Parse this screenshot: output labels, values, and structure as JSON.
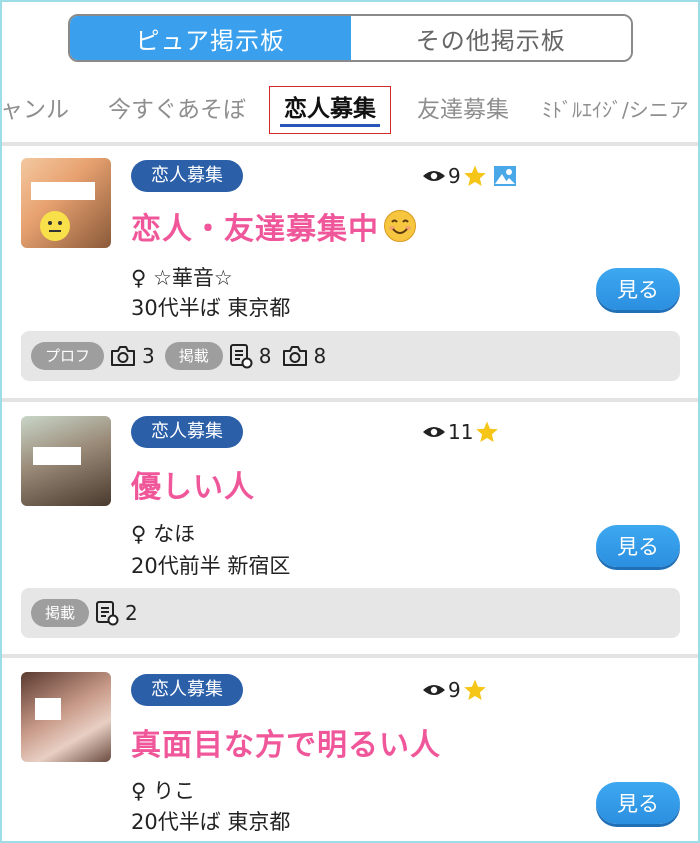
{
  "segments": [
    {
      "label": "ピュア掲示板",
      "active": true
    },
    {
      "label": "その他掲示板",
      "active": false
    }
  ],
  "categories": [
    {
      "label": "ャンル"
    },
    {
      "label": "今すぐあそぼ"
    },
    {
      "label": "恋人募集",
      "active": true
    },
    {
      "label": "友達募集"
    },
    {
      "label": "ﾐﾄﾞﾙｴｲｼﾞ/シニア"
    }
  ],
  "posts": [
    {
      "category": "恋人募集",
      "views": "9",
      "title": "恋人・友達募集中",
      "gender": "♀",
      "name": "☆華音☆",
      "age": "30代半ば",
      "area": "東京都",
      "button": "見る",
      "stats": {
        "profile_label": "プロフ",
        "profile_photos": "3",
        "posted_label": "掲載",
        "posted_count": "8",
        "posted_photos": "8"
      }
    },
    {
      "category": "恋人募集",
      "views": "11",
      "title": "優しい人",
      "gender": "♀",
      "name": "なほ",
      "age": "20代前半",
      "area": "新宿区",
      "button": "見る",
      "stats": {
        "posted_label": "掲載",
        "posted_count": "2"
      }
    },
    {
      "category": "恋人募集",
      "views": "9",
      "title": "真面目な方で明るい人",
      "gender": "♀",
      "name": "りこ",
      "age": "20代半ば",
      "area": "東京都",
      "button": "見る"
    }
  ],
  "icons": {
    "eye": "eye-icon",
    "star": "star-icon",
    "image": "image-icon",
    "camera": "camera-icon",
    "document": "document-icon",
    "smile": "smiling-face-emoji"
  },
  "colors": {
    "segment_active": "#3aa0ee",
    "badge": "#2b5fa8",
    "title_pink": "#f0579a",
    "button_blue": "#3da8f0",
    "star": "#f5c518",
    "stats_bg": "#e6e6e6",
    "tab_underline": "#2a55b8",
    "tab_border": "#d02a2a"
  }
}
